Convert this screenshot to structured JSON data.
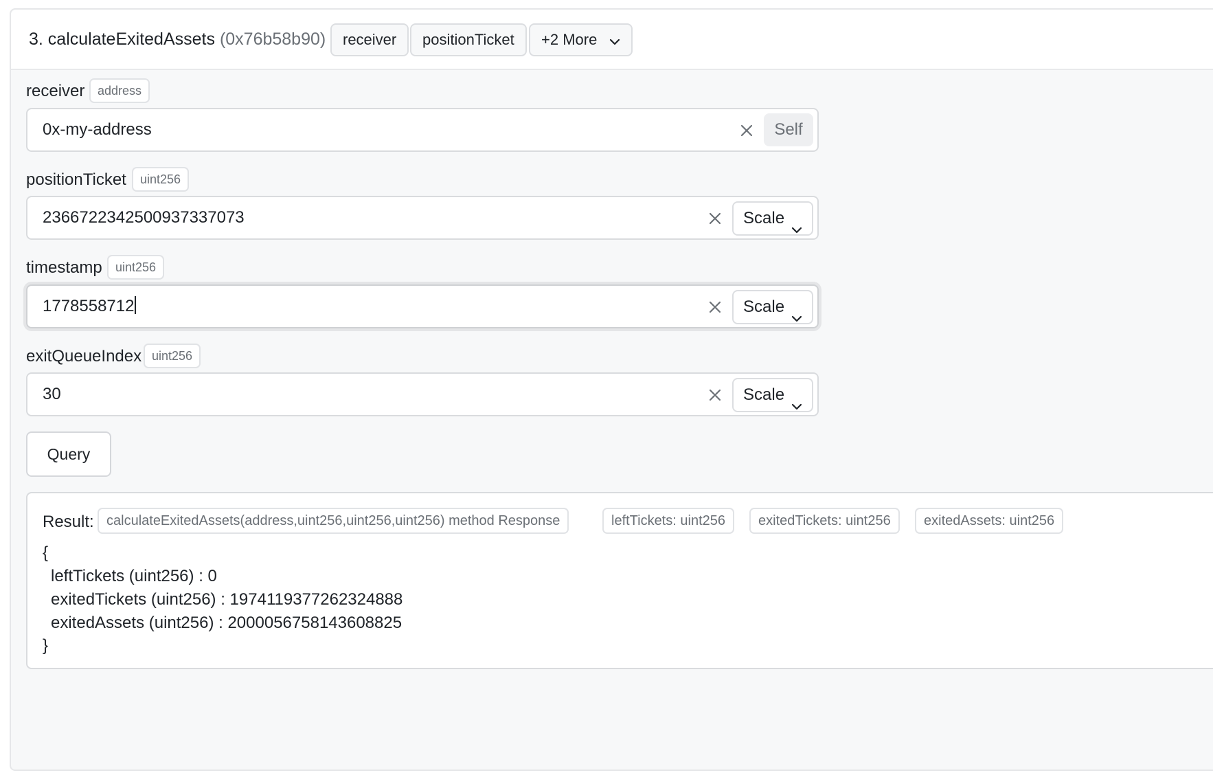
{
  "function": {
    "title": "3. calculateExitedAssets",
    "selector": "(0x76b58b90)",
    "param_chips": [
      "receiver",
      "positionTicket"
    ],
    "more_label": "+2 More"
  },
  "fields": [
    {
      "name": "receiver",
      "type": "address",
      "value": "0x-my-address",
      "action": "Self"
    },
    {
      "name": "positionTicket",
      "type": "uint256",
      "value": "2366722342500937337073",
      "action": "Scale"
    },
    {
      "name": "timestamp",
      "type": "uint256",
      "value": "1778558712",
      "action": "Scale",
      "focused": true
    },
    {
      "name": "exitQueueIndex",
      "type": "uint256",
      "value": "30",
      "action": "Scale"
    }
  ],
  "query_label": "Query",
  "result": {
    "label": "Result:",
    "chips": [
      "calculateExitedAssets(address,uint256,uint256,uint256) method Response",
      "leftTickets: uint256",
      "exitedTickets: uint256",
      "exitedAssets: uint256"
    ],
    "open_brace": "{",
    "lines": [
      "leftTickets (uint256) : 0",
      "exitedTickets (uint256) : 1974119377262324888",
      "exitedAssets (uint256) : 2000056758143608825"
    ],
    "close_brace": "}"
  },
  "icons": {
    "clear": "close-icon",
    "dropdown": "chevron-down-icon"
  },
  "colors": {
    "page_bg": "#ffffff",
    "card_bg": "#f7f8f9",
    "border": "#d9dbde",
    "text": "#1f2328",
    "muted_text": "#6b7076"
  }
}
